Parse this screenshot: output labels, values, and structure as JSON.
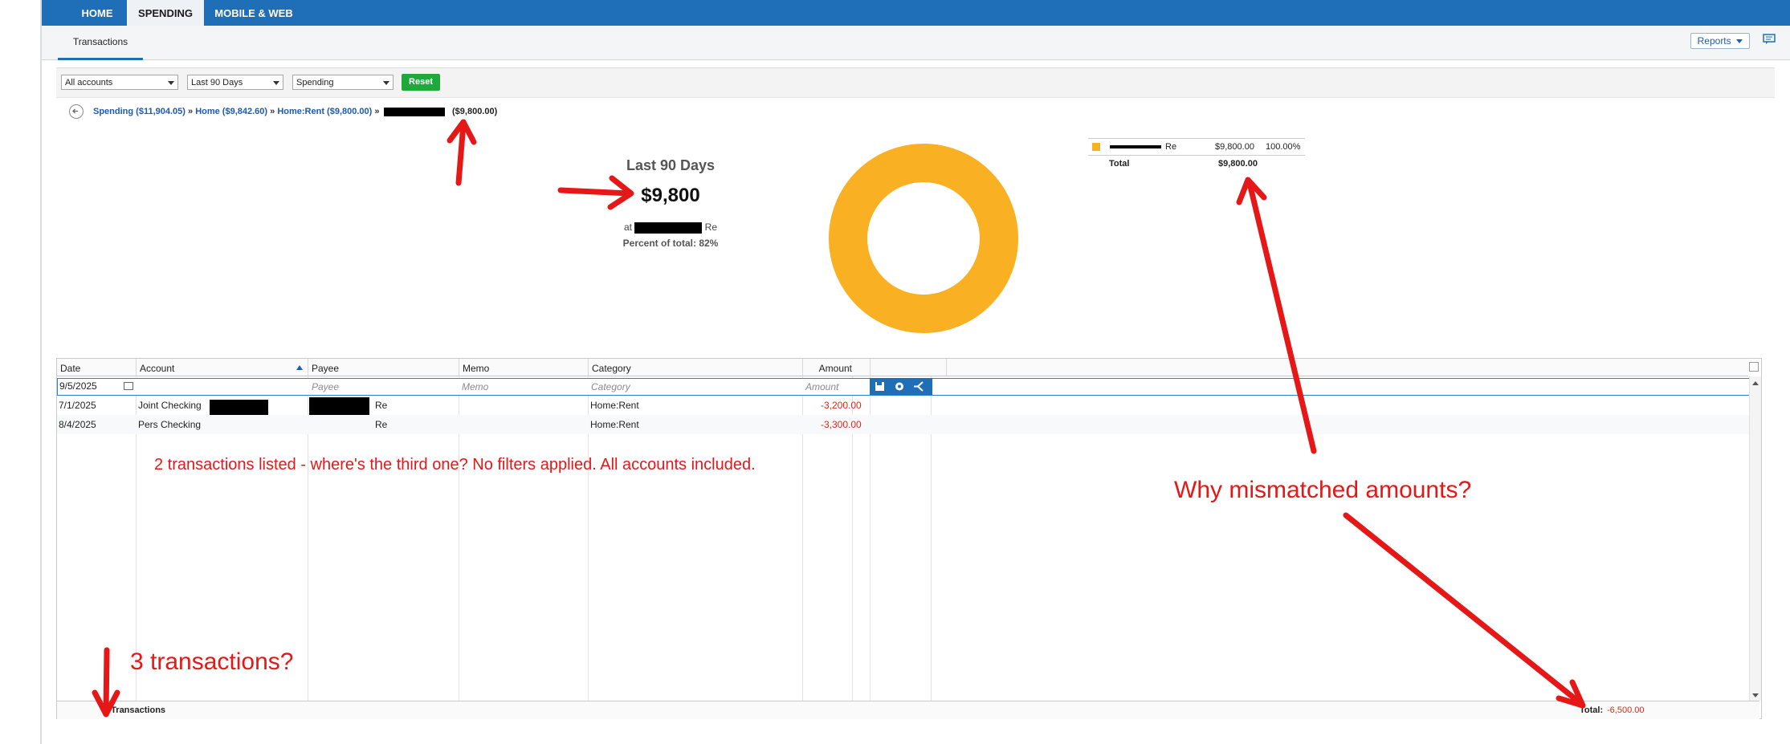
{
  "nav": {
    "tabs": [
      {
        "label": "HOME",
        "active": false
      },
      {
        "label": "SPENDING",
        "active": true
      },
      {
        "label": "MOBILE & WEB",
        "active": false
      }
    ]
  },
  "subnav": {
    "tab": "Transactions",
    "reports_label": "Reports"
  },
  "filters": {
    "account": "All accounts",
    "date_range": "Last 90 Days",
    "type": "Spending",
    "reset_label": "Reset"
  },
  "breadcrumb": {
    "items": [
      "Spending ($11,904.05)",
      "Home ($9,842.60)",
      "Home:Rent ($9,800.00)"
    ],
    "separator": "»",
    "last_amount": "($9,800.00)"
  },
  "summary": {
    "period": "Last 90 Days",
    "amount": "$9,800",
    "at_prefix": "at",
    "at_suffix": "Re",
    "percent_label": "Percent of total: 82%"
  },
  "donut": {
    "color": "#f9b023",
    "percent": 100
  },
  "legend": {
    "rows": [
      {
        "name_suffix": "Re",
        "amount": "$9,800.00",
        "percent": "100.00%",
        "color": "#f9b023"
      }
    ],
    "total_label": "Total",
    "total_amount": "$9,800.00"
  },
  "table": {
    "columns": [
      "Date",
      "Account",
      "Payee",
      "Memo",
      "Category",
      "Amount"
    ],
    "edit_row": {
      "date": "9/5/2025",
      "payee_placeholder": "Payee",
      "memo_placeholder": "Memo",
      "category_placeholder": "Category",
      "amount_placeholder": "Amount"
    },
    "rows": [
      {
        "date": "7/1/2025",
        "account": "Joint Checking",
        "payee_suffix": "Re",
        "category": "Home:Rent",
        "amount": "-3,200.00"
      },
      {
        "date": "8/4/2025",
        "account": "Pers Checking",
        "payee_suffix": "Re",
        "category": "Home:Rent",
        "amount": "-3,300.00"
      }
    ],
    "footer": {
      "count": "3 Transactions",
      "total_label": "Total:",
      "total_value": "-6,500.00"
    }
  },
  "annotations": {
    "missing": "2 transactions listed - where's the third one? No filters applied. All accounts included.",
    "mismatch": "Why mismatched amounts?",
    "three": "3 transactions?",
    "color": "#e61717"
  }
}
